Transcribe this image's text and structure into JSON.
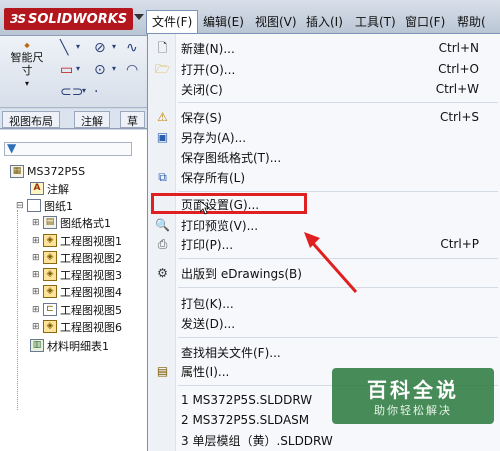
{
  "app": {
    "logo_text": "SOLIDWORKS",
    "logo_mark": "3S"
  },
  "menubar": {
    "items": [
      "文件(F)",
      "编辑(E)",
      "视图(V)",
      "插入(I)",
      "工具(T)",
      "窗口(F)",
      "帮助("
    ]
  },
  "toolbar": {
    "smart_dimension": "智能尺寸"
  },
  "tabs": [
    "视图布局",
    "注解",
    "草"
  ],
  "tree": {
    "root": "MS372P5S",
    "items": [
      "注解",
      "图纸1",
      "图纸格式1",
      "工程图视图1",
      "工程图视图2",
      "工程图视图3",
      "工程图视图4",
      "工程图视图5",
      "工程图视图6",
      "材料明细表1"
    ]
  },
  "file_menu": {
    "items": [
      {
        "label": "新建(N)...",
        "shortcut": "Ctrl+N",
        "icon": "new-document-icon"
      },
      {
        "label": "打开(O)...",
        "shortcut": "Ctrl+O",
        "icon": "open-folder-icon"
      },
      {
        "label": "关闭(C)",
        "shortcut": "Ctrl+W",
        "icon": ""
      },
      {
        "label": "保存(S)",
        "shortcut": "Ctrl+S",
        "icon": "save-icon"
      },
      {
        "label": "另存为(A)...",
        "shortcut": "",
        "icon": "save-as-icon"
      },
      {
        "label": "保存图纸格式(T)...",
        "shortcut": "",
        "icon": ""
      },
      {
        "label": "保存所有(L)",
        "shortcut": "",
        "icon": "save-all-icon"
      },
      {
        "label": "页面设置(G)...",
        "shortcut": "",
        "icon": ""
      },
      {
        "label": "打印预览(V)...",
        "shortcut": "",
        "icon": "print-preview-icon"
      },
      {
        "label": "打印(P)...",
        "shortcut": "Ctrl+P",
        "icon": "printer-icon"
      },
      {
        "label": "出版到 eDrawings(B)",
        "shortcut": "",
        "icon": "edrawings-icon"
      },
      {
        "label": "打包(K)...",
        "shortcut": "",
        "icon": ""
      },
      {
        "label": "发送(D)...",
        "shortcut": "",
        "icon": ""
      },
      {
        "label": "查找相关文件(F)...",
        "shortcut": "",
        "icon": ""
      },
      {
        "label": "属性(I)...",
        "shortcut": "",
        "icon": "properties-icon"
      },
      {
        "label": "1 MS372P5S.SLDDRW",
        "shortcut": "",
        "icon": ""
      },
      {
        "label": "2 MS372P5S.SLDASM",
        "shortcut": "",
        "icon": ""
      },
      {
        "label": "3 单层模组（黄）.SLDDRW",
        "shortcut": "",
        "icon": ""
      }
    ]
  },
  "watermark": {
    "main": "百科全说",
    "sub": "助你轻松解决"
  },
  "colors": {
    "highlight": "#e02020",
    "brand": "#b3171d",
    "watermark_bg": "#287838"
  }
}
